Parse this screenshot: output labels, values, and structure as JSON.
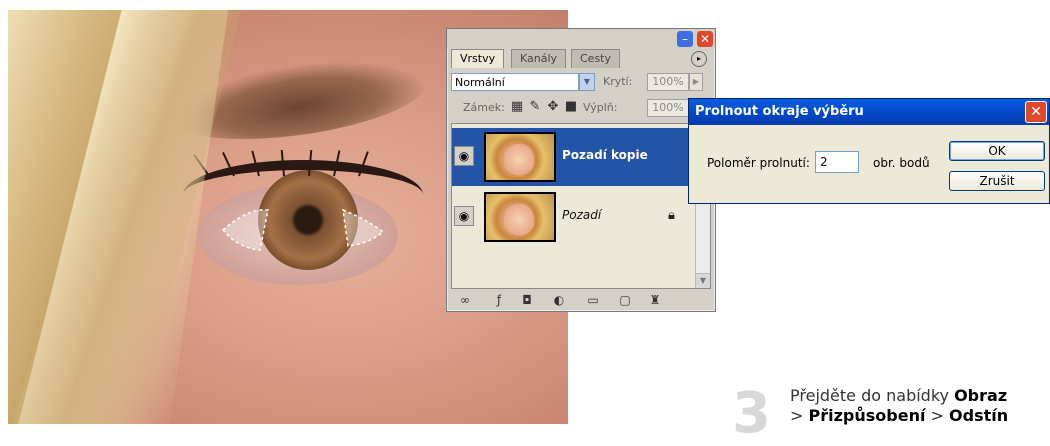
{
  "layers_panel": {
    "tabs": [
      {
        "label": "Vrstvy",
        "active": true
      },
      {
        "label": "Kanály",
        "active": false
      },
      {
        "label": "Cesty",
        "active": false
      }
    ],
    "blend_mode": "Normální",
    "opacity_label": "Krytí:",
    "opacity_value": "100%",
    "lock_label": "Zámek:",
    "fill_label": "Výplň:",
    "fill_value": "100%",
    "layers": [
      {
        "name": "Pozadí kopie",
        "selected": true,
        "locked": false
      },
      {
        "name": "Pozadí",
        "selected": false,
        "locked": true
      }
    ]
  },
  "dialog": {
    "title": "Prolnout okraje výběru",
    "radius_label": "Poloměr prolnutí:",
    "radius_value": "2",
    "unit_label": "obr. bodů",
    "ok_label": "OK",
    "cancel_label": "Zrušit"
  },
  "caption": {
    "step_number": "3",
    "line1_prefix": "Přejděte do nabídky ",
    "menu1": "Obraz",
    "line2_sep1": "> ",
    "menu2": "Přizpůsobení",
    "line2_sep2": " > ",
    "menu3": "Odstín"
  },
  "colors": {
    "selection_blue": "#2354a8",
    "titlebar_blue": "#0a5de0",
    "close_red": "#e0482e",
    "panel_gray": "#d4d0c8"
  }
}
